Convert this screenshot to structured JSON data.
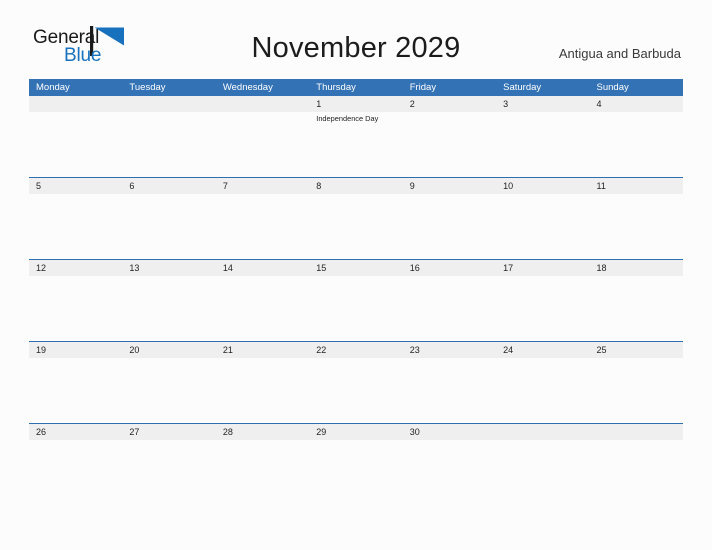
{
  "brand": {
    "name_part1": "General",
    "name_part2": "Blue",
    "flag_color": "#1771bd",
    "text_color": "#1a1a1a"
  },
  "header": {
    "title": "November 2029",
    "country": "Antigua and Barbuda"
  },
  "theme": {
    "header_blue": "#3372b5",
    "row_line_blue": "#2f6fb0",
    "band_gray": "#efefef",
    "page_background": "#fcfcfc"
  },
  "calendar": {
    "weekdays": [
      "Monday",
      "Tuesday",
      "Wednesday",
      "Thursday",
      "Friday",
      "Saturday",
      "Sunday"
    ],
    "weeks": [
      {
        "days": [
          {
            "date": "",
            "event": ""
          },
          {
            "date": "",
            "event": ""
          },
          {
            "date": "",
            "event": ""
          },
          {
            "date": "1",
            "event": "Independence Day"
          },
          {
            "date": "2",
            "event": ""
          },
          {
            "date": "3",
            "event": ""
          },
          {
            "date": "4",
            "event": ""
          }
        ]
      },
      {
        "days": [
          {
            "date": "5",
            "event": ""
          },
          {
            "date": "6",
            "event": ""
          },
          {
            "date": "7",
            "event": ""
          },
          {
            "date": "8",
            "event": ""
          },
          {
            "date": "9",
            "event": ""
          },
          {
            "date": "10",
            "event": ""
          },
          {
            "date": "11",
            "event": ""
          }
        ]
      },
      {
        "days": [
          {
            "date": "12",
            "event": ""
          },
          {
            "date": "13",
            "event": ""
          },
          {
            "date": "14",
            "event": ""
          },
          {
            "date": "15",
            "event": ""
          },
          {
            "date": "16",
            "event": ""
          },
          {
            "date": "17",
            "event": ""
          },
          {
            "date": "18",
            "event": ""
          }
        ]
      },
      {
        "days": [
          {
            "date": "19",
            "event": ""
          },
          {
            "date": "20",
            "event": ""
          },
          {
            "date": "21",
            "event": ""
          },
          {
            "date": "22",
            "event": ""
          },
          {
            "date": "23",
            "event": ""
          },
          {
            "date": "24",
            "event": ""
          },
          {
            "date": "25",
            "event": ""
          }
        ]
      },
      {
        "days": [
          {
            "date": "26",
            "event": ""
          },
          {
            "date": "27",
            "event": ""
          },
          {
            "date": "28",
            "event": ""
          },
          {
            "date": "29",
            "event": ""
          },
          {
            "date": "30",
            "event": ""
          },
          {
            "date": "",
            "event": ""
          },
          {
            "date": "",
            "event": ""
          }
        ]
      }
    ]
  }
}
